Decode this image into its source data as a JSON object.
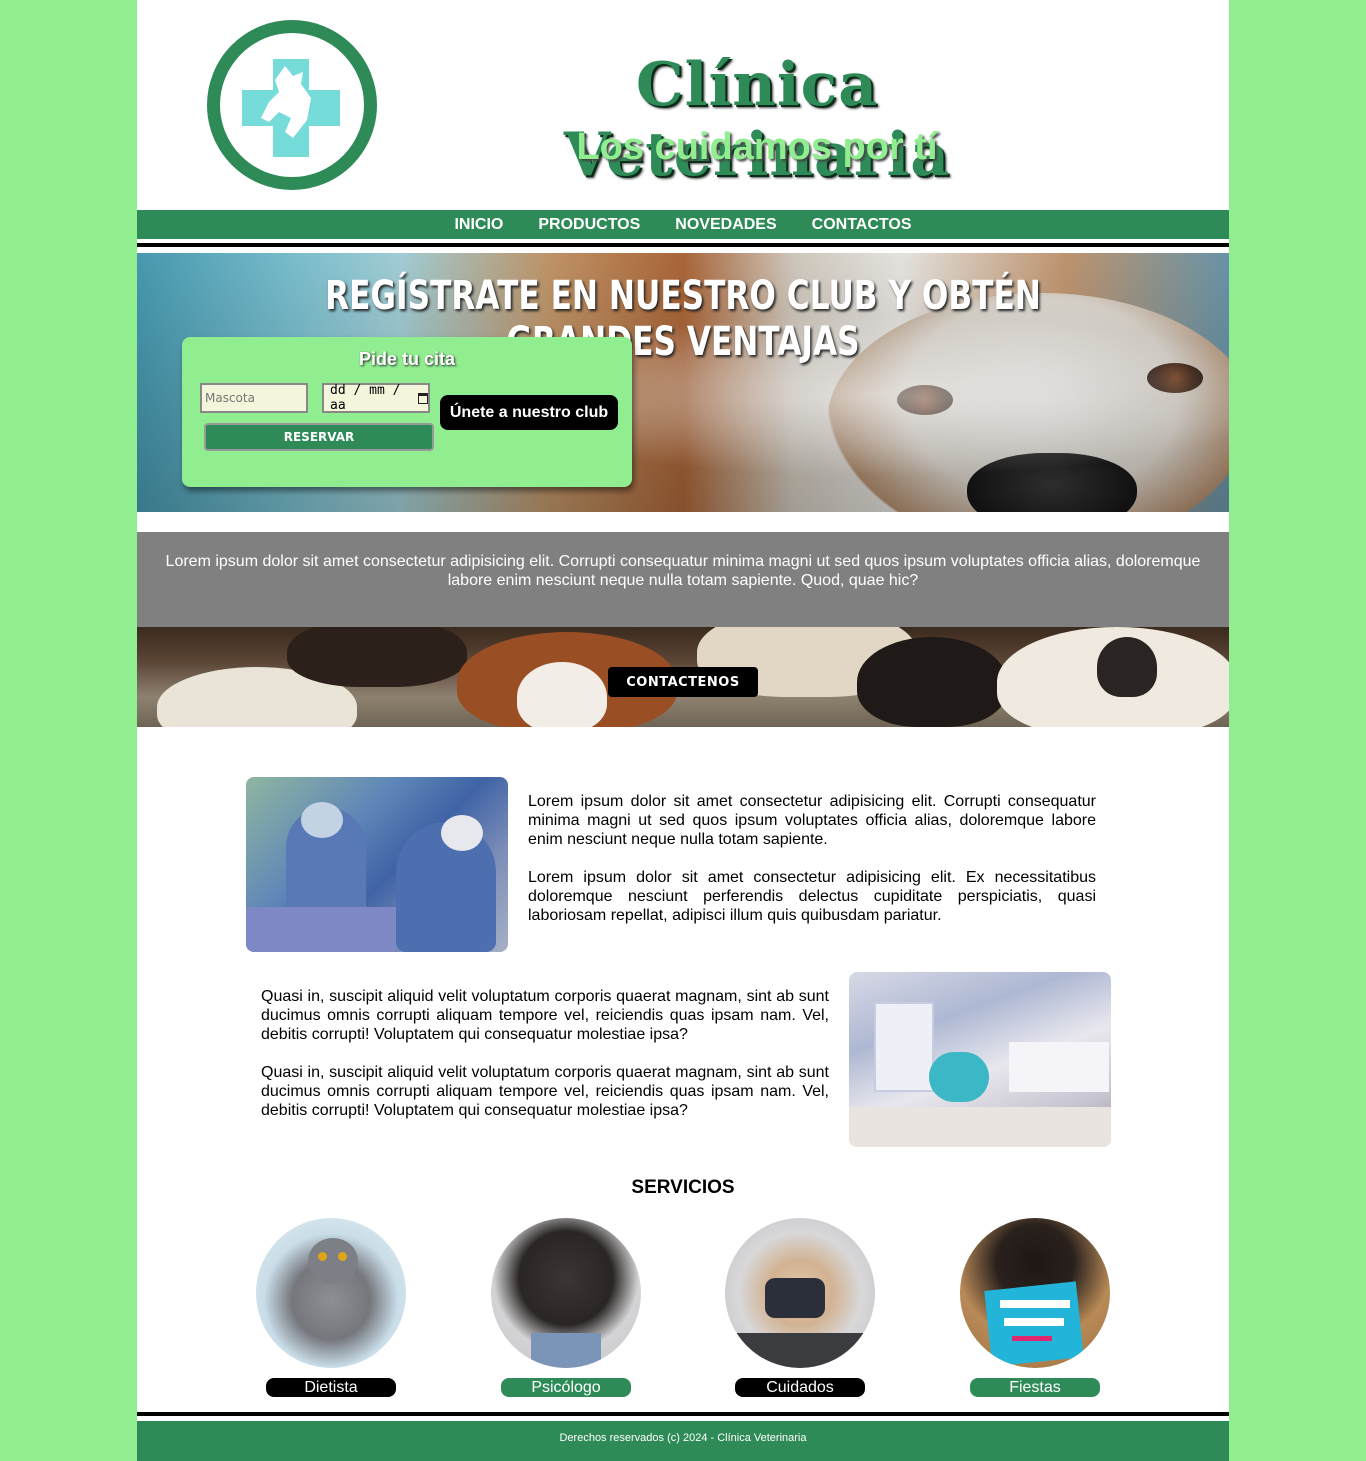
{
  "header": {
    "title": "Clínica Veterinaria",
    "subtitle": "Los cuidamos por tí"
  },
  "nav": {
    "items": [
      "INICIO",
      "PRODUCTOS",
      "NOVEDADES",
      "CONTACTOS"
    ]
  },
  "hero": {
    "title": "REGÍSTRATE EN NUESTRO CLUB Y OBTÉN GRANDES VENTAJAS",
    "booking": {
      "heading": "Pide tu cita",
      "pet_placeholder": "Mascota",
      "date_placeholder": "dd / mm / aa",
      "reserve_label": "RESERVAR"
    },
    "club_button": "Únete a nuestro club"
  },
  "intro": {
    "text": "Lorem ipsum dolor sit amet consectetur adipisicing elit. Corrupti consequatur minima magni ut sed quos ipsum voluptates officia alias, doloremque labore enim nesciunt neque nulla totam sapiente. Quod, quae hic?"
  },
  "contact_button": "CONTACTENOS",
  "content": {
    "block1": [
      "Lorem ipsum dolor sit amet consectetur adipisicing elit. Corrupti consequatur minima magni ut sed quos ipsum voluptates officia alias, doloremque labore enim nesciunt neque nulla totam sapiente.",
      "Lorem ipsum dolor sit amet consectetur adipisicing elit. Ex necessitatibus doloremque nesciunt perferendis delectus cupiditate perspiciatis, quasi laboriosam repellat, adipisci illum quis quibusdam pariatur."
    ],
    "block2": [
      "Quasi in, suscipit aliquid velit voluptatum corporis quaerat magnam, sint ab sunt ducimus omnis corrupti aliquam tempore vel, reiciendis quas ipsam nam. Vel, debitis corrupti! Voluptatem qui consequatur molestiae ipsa?",
      "Quasi in, suscipit aliquid velit voluptatum corporis quaerat magnam, sint ab sunt ducimus omnis corrupti aliquam tempore vel, reiciendis quas ipsam nam. Vel, debitis corrupti! Voluptatem qui consequatur molestiae ipsa?"
    ]
  },
  "services": {
    "title": "SERVICIOS",
    "items": [
      {
        "label": "Dietista",
        "color": "#000000"
      },
      {
        "label": "Psicólogo",
        "color": "#2e8b57"
      },
      {
        "label": "Cuidados",
        "color": "#000000"
      },
      {
        "label": "Fiestas",
        "color": "#2e8b57"
      }
    ]
  },
  "footer": {
    "text": "Derechos reservados (c) 2024 - Clínica Veterinaria"
  },
  "colors": {
    "background": "#90ee90",
    "brand": "#2e8b57",
    "logo_cross": "#76dcd9",
    "grey_band": "#808080"
  },
  "icons": {
    "logo": "vet-cross-pet-icon",
    "calendar": "calendar-icon"
  }
}
